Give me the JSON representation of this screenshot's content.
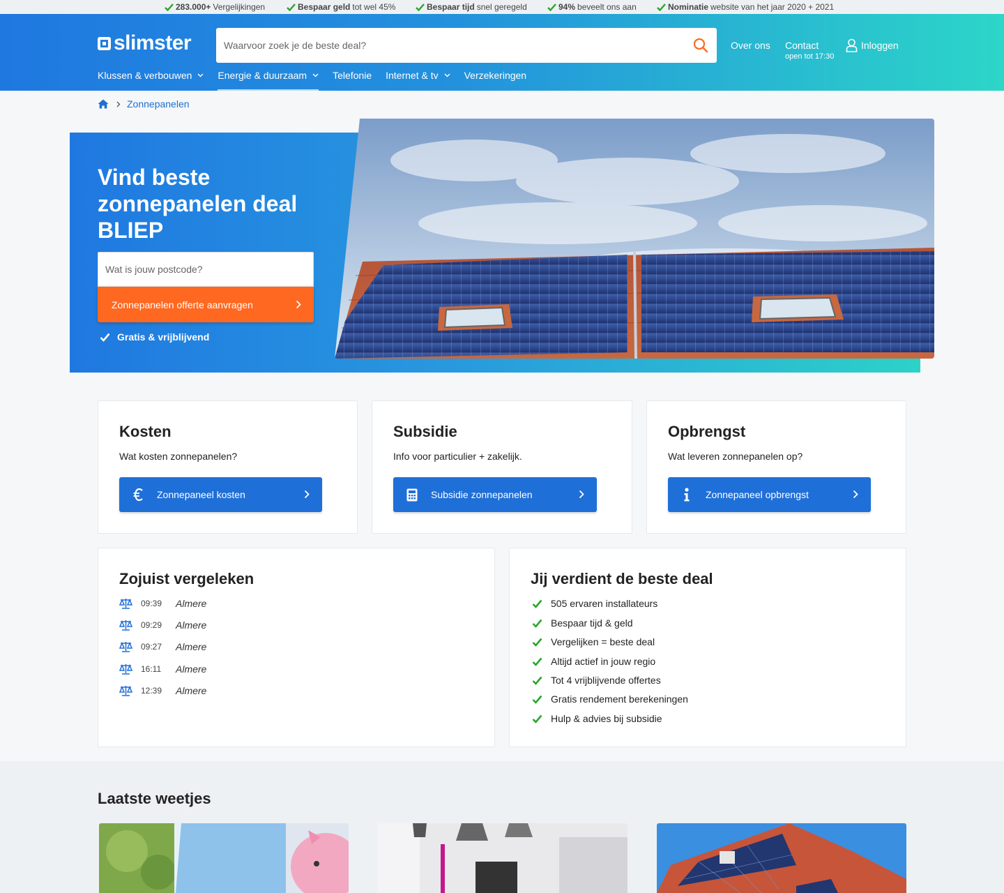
{
  "usps": [
    {
      "bold": "283.000+",
      "text": "Vergelijkingen"
    },
    {
      "bold": "Bespaar geld",
      "text": "tot wel 45%"
    },
    {
      "bold": "Bespaar tijd",
      "text": "snel geregeld"
    },
    {
      "bold": "94%",
      "text": "beveelt ons aan"
    },
    {
      "bold": "Nominatie",
      "text": "website van het jaar 2020 + 2021"
    }
  ],
  "header": {
    "logo": "slimster",
    "search_placeholder": "Waarvoor zoek je de beste deal?",
    "about": "Over ons",
    "contact": "Contact",
    "contact_hours": "open tot 17:30",
    "login": "Inloggen"
  },
  "nav": [
    {
      "label": "Klussen & verbouwen",
      "dropdown": true
    },
    {
      "label": "Energie & duurzaam",
      "dropdown": true,
      "active": true
    },
    {
      "label": "Telefonie",
      "dropdown": false
    },
    {
      "label": "Internet & tv",
      "dropdown": true
    },
    {
      "label": "Verzekeringen",
      "dropdown": false
    }
  ],
  "breadcrumb": {
    "current": "Zonnepanelen"
  },
  "hero": {
    "title": "Vind beste zonnepanelen deal BLIEP",
    "postcode_placeholder": "Wat is jouw postcode?",
    "cta": "Zonnepanelen offerte aanvragen",
    "check": "Gratis & vrijblijvend"
  },
  "cards": [
    {
      "title": "Kosten",
      "subtitle": "Wat kosten zonnepanelen?",
      "button": "Zonnepaneel kosten",
      "icon": "euro-icon"
    },
    {
      "title": "Subsidie",
      "subtitle": "Info voor particulier + zakelijk.",
      "button": "Subsidie zonnepanelen",
      "icon": "calculator-icon"
    },
    {
      "title": "Opbrengst",
      "subtitle": "Wat leveren zonnepanelen op?",
      "button": "Zonnepaneel opbrengst",
      "icon": "info-icon"
    }
  ],
  "recent": {
    "title": "Zojuist vergeleken",
    "items": [
      {
        "time": "09:39",
        "city": "Almere"
      },
      {
        "time": "09:29",
        "city": "Almere"
      },
      {
        "time": "09:27",
        "city": "Almere"
      },
      {
        "time": "16:11",
        "city": "Almere"
      },
      {
        "time": "12:39",
        "city": "Almere"
      }
    ]
  },
  "deal": {
    "title": "Jij verdient de beste deal",
    "items": [
      "505 ervaren installateurs",
      "Bespaar tijd & geld",
      "Vergelijken = beste deal",
      "Altijd actief in jouw regio",
      "Tot 4 vrijblijvende offertes",
      "Gratis rendement berekeningen",
      "Hulp & advies bij subsidie"
    ]
  },
  "news": {
    "title": "Laatste weetjes"
  },
  "colors": {
    "accent_blue": "#1f6fd8",
    "cta_orange": "#ff6820",
    "check_green": "#2aa52a",
    "gradient_end": "#2cd6c8"
  }
}
